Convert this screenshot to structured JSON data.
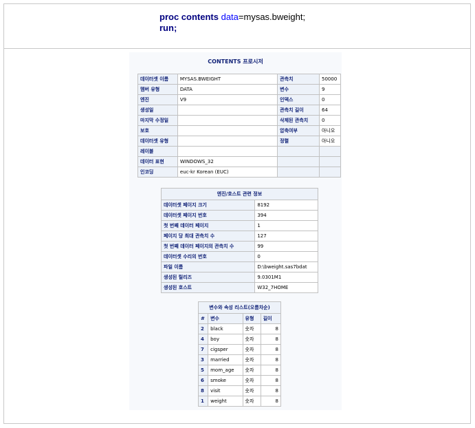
{
  "code": {
    "line1_kw": "proc contents",
    "line1_attr": "data",
    "line1_val": "=mysas.bweight;",
    "line2_kw": "run;"
  },
  "contents": {
    "title": "CONTENTS 프로시저",
    "rows": [
      [
        "데이터셋 이름",
        "MYSAS.BWEIGHT",
        "관측치",
        "50000"
      ],
      [
        "멤버 유형",
        "DATA",
        "변수",
        "9"
      ],
      [
        "엔진",
        "V9",
        "인덱스",
        "0"
      ],
      [
        "생성일",
        "",
        "관측치 길이",
        "64"
      ],
      [
        "마지막 수정일",
        "",
        "삭제된 관측치",
        "0"
      ],
      [
        "보호",
        "",
        "압축여부",
        "아니오"
      ],
      [
        "데이터셋 유형",
        "",
        "정렬",
        "아니오"
      ],
      [
        "레이블",
        "",
        "",
        ""
      ],
      [
        "데이터 표현",
        "WINDOWS_32",
        "",
        ""
      ],
      [
        "인코딩",
        "euc-kr Korean (EUC)",
        "",
        ""
      ]
    ]
  },
  "engine": {
    "caption": "엔진/호스트 관련 정보",
    "rows": [
      [
        "데이터셋 페이지 크기",
        "8192"
      ],
      [
        "데이터셋 페이지 번호",
        "394"
      ],
      [
        "첫 번째 데이터 페이지",
        "1"
      ],
      [
        "페이지 당 최대 관측치 수",
        "127"
      ],
      [
        "첫 번째 데이터 페이지의 관측치 수",
        "99"
      ],
      [
        "데이터셋 수리의 번호",
        "0"
      ],
      [
        "파일 이름",
        "D:\\bweight.sas7bdat"
      ],
      [
        "생성된 릴리즈",
        "9.0301M1"
      ],
      [
        "생성된 호스트",
        "W32_7HOME"
      ]
    ]
  },
  "vars": {
    "caption": "변수와 속성 리스트(오름차순)",
    "headers": [
      "#",
      "변수",
      "유형",
      "길이"
    ],
    "rows": [
      [
        "2",
        "black",
        "숫자",
        "8"
      ],
      [
        "4",
        "boy",
        "숫자",
        "8"
      ],
      [
        "7",
        "cigsper",
        "숫자",
        "8"
      ],
      [
        "3",
        "married",
        "숫자",
        "8"
      ],
      [
        "5",
        "mom_age",
        "숫자",
        "8"
      ],
      [
        "6",
        "smoke",
        "숫자",
        "8"
      ],
      [
        "8",
        "visit",
        "숫자",
        "8"
      ],
      [
        "1",
        "weight",
        "숫자",
        "8"
      ]
    ]
  }
}
